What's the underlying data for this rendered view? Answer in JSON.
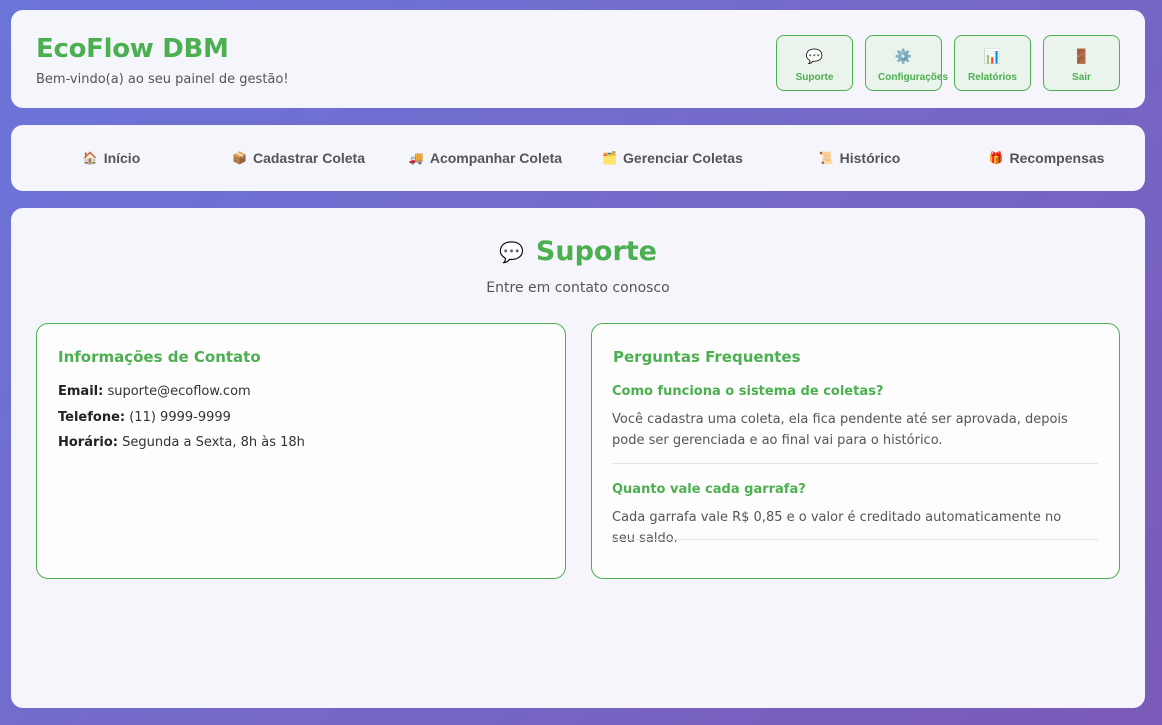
{
  "header": {
    "brand": "EcoFlow DBM",
    "welcome": "Bem-vindo(a) ao seu painel de gestão!",
    "buttons": [
      {
        "icon": "💬",
        "label": "Suporte"
      },
      {
        "icon": "⚙️",
        "label": "Configurações"
      },
      {
        "icon": "📊",
        "label": "Relatórios"
      },
      {
        "icon": "🚪",
        "label": "Sair"
      }
    ]
  },
  "nav": {
    "items": [
      {
        "icon": "🏠",
        "label": "Início"
      },
      {
        "icon": "📦",
        "label": "Cadastrar Coleta"
      },
      {
        "icon": "🚚",
        "label": "Acompanhar Coleta"
      },
      {
        "icon": "🗂️",
        "label": "Gerenciar Coletas"
      },
      {
        "icon": "📜",
        "label": "Histórico"
      },
      {
        "icon": "🎁",
        "label": "Recompensas"
      }
    ]
  },
  "main": {
    "icon": "💬",
    "title": "Suporte",
    "subtitle": "Entre em contato conosco",
    "contact": {
      "heading": "Informações de Contato",
      "email_label": "Email:",
      "email_value": "suporte@ecoflow.com",
      "phone_label": "Telefone:",
      "phone_value": "(11) 9999-9999",
      "hours_label": "Horário:",
      "hours_value": "Segunda a Sexta, 8h às 18h"
    },
    "faq": {
      "heading": "Perguntas Frequentes",
      "items": [
        {
          "question": "Como funciona o sistema de coletas?",
          "answer": "Você cadastra uma coleta, ela fica pendente até ser aprovada, depois pode ser gerenciada e ao final vai para o histórico."
        },
        {
          "question": "Quanto vale cada garrafa?",
          "answer": "Cada garrafa vale R$ 0,85 e o valor é creditado automaticamente no seu saldo."
        }
      ]
    }
  }
}
